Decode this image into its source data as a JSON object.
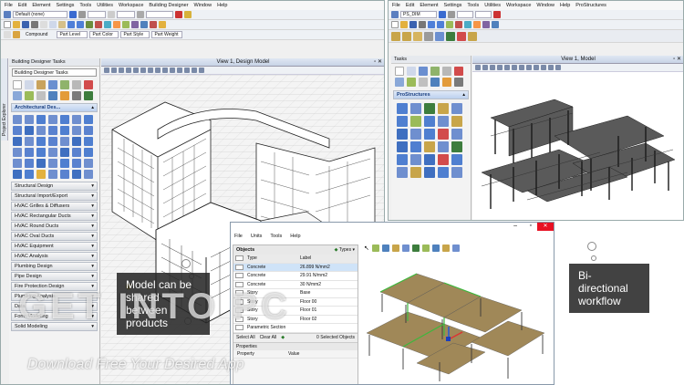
{
  "left_app": {
    "menu": [
      "File",
      "Edit",
      "Element",
      "Settings",
      "Tools",
      "Utilities",
      "Workspace",
      "Building Designer",
      "Window",
      "Help"
    ],
    "level_combo": "Default (none)",
    "compound_label": "Compound",
    "part_labels": [
      "Part Level",
      "Part Color",
      "Part Style",
      "Part Weight"
    ],
    "tasks_panel_title": "Building Designer Tasks",
    "tasks_combo": "Building Designer Tasks",
    "arch_section": "Architectural Des...",
    "sections": [
      "Structural Design",
      "Structural Import/Export",
      "HVAC Grilles & Diffusers",
      "HVAC Rectangular Ducts",
      "HVAC Round Ducts",
      "HVAC Oval Ducts",
      "HVAC Equipment",
      "HVAC Analysis",
      "Plumbing Design",
      "Pipe Design",
      "Fire Protection Design",
      "Plumbing Analysis",
      "Data",
      "Form Modeling",
      "Solid Modeling"
    ],
    "side_tab": "Project Explorer",
    "view_title": "View 1, Design Model"
  },
  "right_app": {
    "menu": [
      "File",
      "Edit",
      "Element",
      "Settings",
      "Tools",
      "Utilities",
      "Workspace",
      "Window",
      "Help",
      "ProStructures"
    ],
    "level_combo": "PS_DIM",
    "tasks_title": "Tasks",
    "section": "ProStructures",
    "view_title": "View 1, Model"
  },
  "objects_window": {
    "menu": [
      "File",
      "Units",
      "Tools",
      "Help"
    ],
    "objects_title": "Objects",
    "types_label": "Types",
    "columns": [
      "Type",
      "Label"
    ],
    "rows": [
      {
        "type": "Concrete",
        "label": "26.899 N/mm2",
        "selected": true
      },
      {
        "type": "Concrete",
        "label": "29.91 N/mm2",
        "selected": false
      },
      {
        "type": "Concrete",
        "label": "30 N/mm2",
        "selected": false
      },
      {
        "type": "Story",
        "label": "Base",
        "selected": false
      },
      {
        "type": "Story",
        "label": "Floor 00",
        "selected": false
      },
      {
        "type": "Story",
        "label": "Floor 01",
        "selected": false
      },
      {
        "type": "Story",
        "label": "Floor 02",
        "selected": false
      },
      {
        "type": "Parametric Section",
        "label": "",
        "selected": false
      }
    ],
    "select_all": "Select All",
    "clear_all": "Clear All",
    "selected_count": "0 Selected Objects",
    "properties_title": "Properties",
    "prop_columns": [
      "Property",
      "Value"
    ]
  },
  "callouts": {
    "left": "Model can be shared between products",
    "right": "Bi-directional workflow"
  },
  "watermark": {
    "logo": "GET INTO PC",
    "tagline": "Download Free Your Desired App"
  },
  "colors": {
    "accent_blue": "#1a5fb4",
    "callout_bg": "#2b2b2b",
    "slab_brown": "#a08858",
    "highlight_green": "#3db83d"
  }
}
